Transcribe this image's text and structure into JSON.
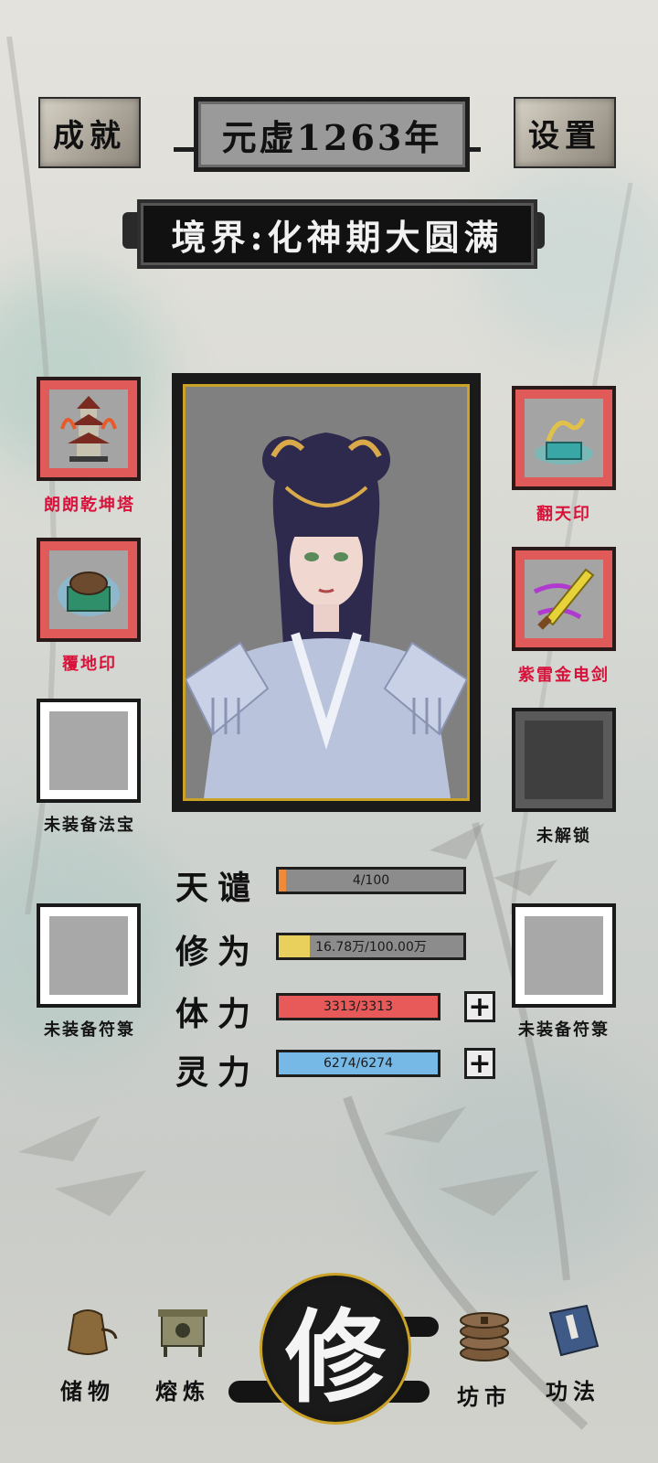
{
  "header": {
    "achievements_label": "成就",
    "settings_label": "设置",
    "year": "元虚1263年",
    "realm": "境界:化神期大圆满"
  },
  "left_slots": [
    {
      "label": "朗朗乾坤塔",
      "icon": "pagoda-icon",
      "color": "red"
    },
    {
      "label": "覆地印",
      "icon": "turtle-seal-icon",
      "color": "red"
    },
    {
      "label": "未装备法宝",
      "color": "dark"
    },
    {
      "label": "未装备符箓",
      "color": "dark"
    }
  ],
  "right_slots": [
    {
      "label": "翻天印",
      "icon": "dragon-seal-icon",
      "color": "red"
    },
    {
      "label": "紫雷金电剑",
      "icon": "lightning-sword-icon",
      "color": "red"
    },
    {
      "label": "未解锁",
      "color": "dark",
      "locked": true
    },
    {
      "label": "未装备符箓",
      "color": "dark"
    }
  ],
  "stats": [
    {
      "label": "天谴",
      "value": "4/100",
      "fraction": 0.04,
      "color": "#f0893a"
    },
    {
      "label": "修为",
      "value": "16.78万/100.00万",
      "fraction": 0.168,
      "color": "#e9cf5c"
    },
    {
      "label": "体力",
      "value": "3313/3313",
      "fraction": 1.0,
      "color": "#e85a5a",
      "has_plus": true
    },
    {
      "label": "灵力",
      "value": "6274/6274",
      "fraction": 1.0,
      "color": "#76b8e6",
      "has_plus": true
    }
  ],
  "plus_label": "+",
  "nav": {
    "storage": "储物",
    "smelting": "熔炼",
    "cultivate": "修",
    "market": "坊市",
    "techniques": "功法"
  }
}
